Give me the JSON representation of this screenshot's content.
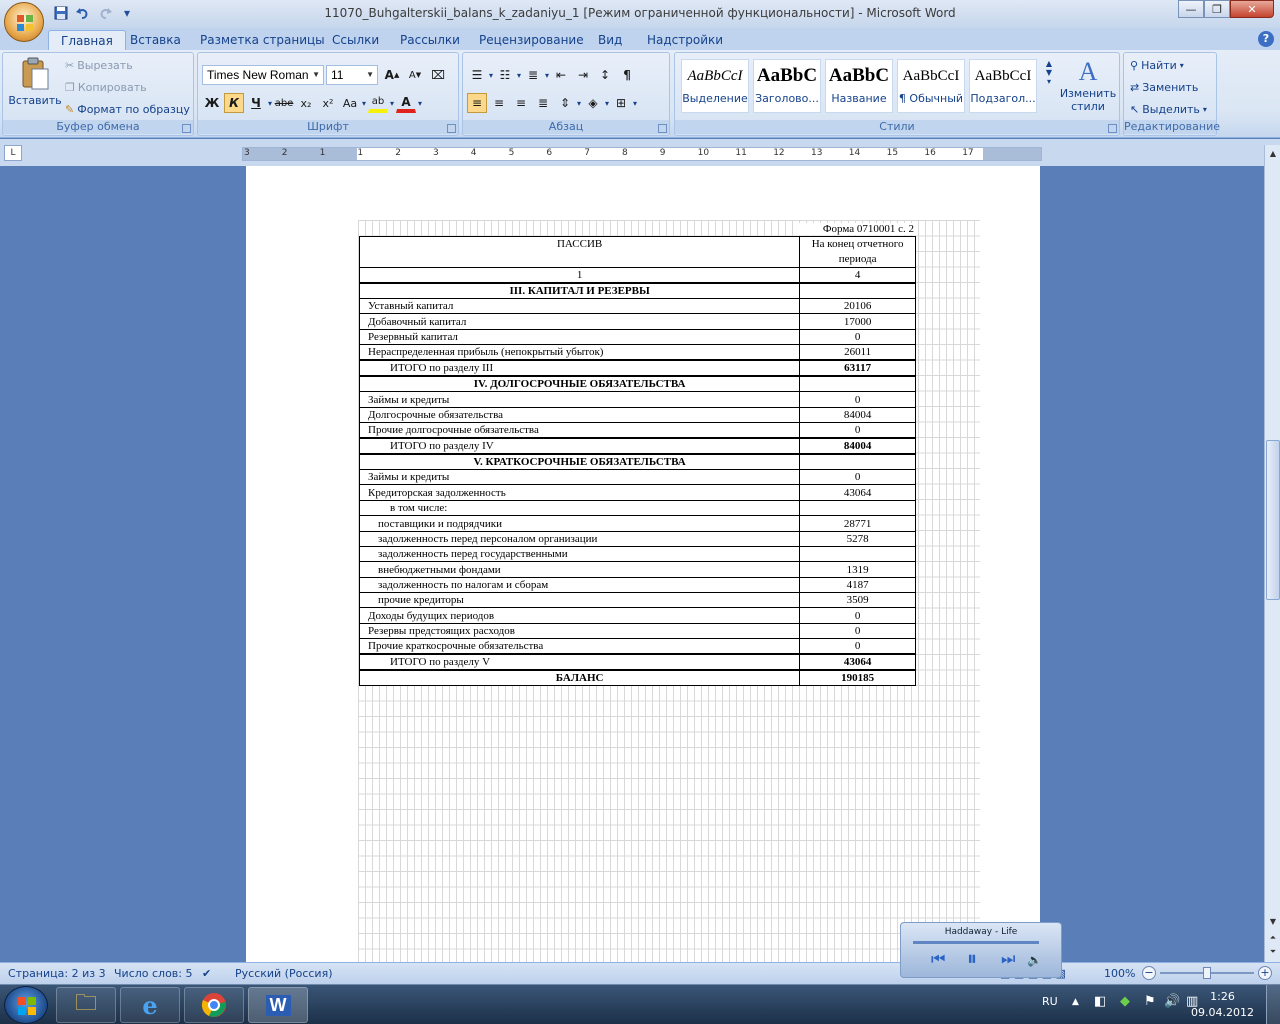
{
  "window": {
    "title": "11070_Buhgalterskii_balans_k_zadaniyu_1 [Режим ограниченной функциональности] - Microsoft Word",
    "minimize_glyph": "—",
    "maximize_glyph": "❐",
    "close_glyph": "✕"
  },
  "quick_access": {
    "save_icon": "save-icon",
    "undo_icon": "undo-icon",
    "redo_icon": "redo-icon",
    "customize_glyph": "▾"
  },
  "tabs": [
    {
      "label": "Главная",
      "active": true
    },
    {
      "label": "Вставка"
    },
    {
      "label": "Разметка страницы"
    },
    {
      "label": "Ссылки"
    },
    {
      "label": "Рассылки"
    },
    {
      "label": "Рецензирование"
    },
    {
      "label": "Вид"
    },
    {
      "label": "Надстройки"
    }
  ],
  "help_glyph": "?",
  "ribbon": {
    "clipboard": {
      "label": "Буфер обмена",
      "paste": "Вставить",
      "cut": "Вырезать",
      "copy": "Копировать",
      "format_painter": "Формат по образцу"
    },
    "font": {
      "label": "Шрифт",
      "font_name": "Times New Roman",
      "font_size": "11",
      "bold": "Ж",
      "italic": "К",
      "underline": "Ч",
      "strike": "abe",
      "subscript": "x₂",
      "superscript": "x²",
      "change_case": "Aa",
      "grow": "A",
      "shrink": "A",
      "highlight": "ab",
      "font_color": "A"
    },
    "paragraph": {
      "label": "Абзац",
      "show_marks": "¶"
    },
    "styles": {
      "label": "Стили",
      "items": [
        {
          "preview": "AaBbCcI",
          "name": "Выделение"
        },
        {
          "preview": "AaBbC",
          "name": "Заголово..."
        },
        {
          "preview": "AaBbC",
          "name": "Название"
        },
        {
          "preview": "AaBbCcI",
          "name": "¶ Обычный"
        },
        {
          "preview": "AaBbCcI",
          "name": "Подзагол..."
        }
      ],
      "change_styles": "Изменить стили"
    },
    "editing": {
      "label": "Редактирование",
      "find": "Найти",
      "replace": "Заменить",
      "select": "Выделить"
    }
  },
  "ruler": {
    "corner": "L",
    "marks": [
      "3",
      "2",
      "1",
      "1",
      "2",
      "3",
      "4",
      "5",
      "6",
      "7",
      "8",
      "9",
      "10",
      "11",
      "12",
      "13",
      "14",
      "15",
      "16",
      "17"
    ]
  },
  "document": {
    "form_ref": "Форма 0710001 с. 2",
    "header_left": "ПАССИВ",
    "header_right": "На конец отчетного периода",
    "colnum_left": "1",
    "colnum_right": "4",
    "sections": [
      {
        "title": "III. КАПИТАЛ И РЕЗЕРВЫ",
        "rows": [
          {
            "label": "Уставный капитал",
            "value": "20106"
          },
          {
            "label": "Добавочный капитал",
            "value": "17000"
          },
          {
            "label": "Резервный капитал",
            "value": "0"
          },
          {
            "label": "Нераспределенная прибыль (непокрытый убыток)",
            "value": "26011"
          }
        ],
        "total_label": "ИТОГО по разделу III",
        "total_value": "63117"
      },
      {
        "title": "IV. ДОЛГОСРОЧНЫЕ ОБЯЗАТЕЛЬСТВА",
        "rows": [
          {
            "label": "Займы и кредиты",
            "value": "0"
          },
          {
            "label": "Долгосрочные обязательства",
            "value": "84004"
          },
          {
            "label": "Прочие долгосрочные обязательства",
            "value": "0"
          }
        ],
        "total_label": "ИТОГО по разделу IV",
        "total_value": "84004"
      },
      {
        "title": "V. КРАТКОСРОЧНЫЕ ОБЯЗАТЕЛЬСТВА",
        "rows": [
          {
            "label": "Займы и кредиты",
            "value": "0"
          },
          {
            "label": "Кредиторская задолженность",
            "value": "43064"
          },
          {
            "label": "в том числе:",
            "value": "",
            "indent": 1
          },
          {
            "label": "поставщики и подрядчики",
            "value": "28771",
            "indent": 2
          },
          {
            "label": "задолженность перед персоналом организации",
            "value": "5278",
            "indent": 2
          },
          {
            "label": "задолженность перед государственными",
            "value": "",
            "indent": 2
          },
          {
            "label": "внебюджетными фондами",
            "value": "1319",
            "indent": 2
          },
          {
            "label": "задолженность по налогам и сборам",
            "value": "4187",
            "indent": 2
          },
          {
            "label": "прочие кредиторы",
            "value": "3509",
            "indent": 2
          },
          {
            "label": "Доходы будущих периодов",
            "value": "0"
          },
          {
            "label": "Резервы предстоящих расходов",
            "value": "0"
          },
          {
            "label": "Прочие краткосрочные обязательства",
            "value": "0"
          }
        ],
        "total_label": "ИТОГО по разделу V",
        "total_value": "43064"
      }
    ],
    "balance_label": "БАЛАНС",
    "balance_value": "190185"
  },
  "player": {
    "song": "Haddaway - Life"
  },
  "statusbar": {
    "page": "Страница: 2 из 3",
    "words": "Число слов: 5",
    "language": "Русский (Россия)",
    "zoom": "100%",
    "zoom_minus": "−",
    "zoom_plus": "+"
  },
  "taskbar": {
    "lang": "RU",
    "time": "1:26",
    "date": "09.04.2012"
  }
}
